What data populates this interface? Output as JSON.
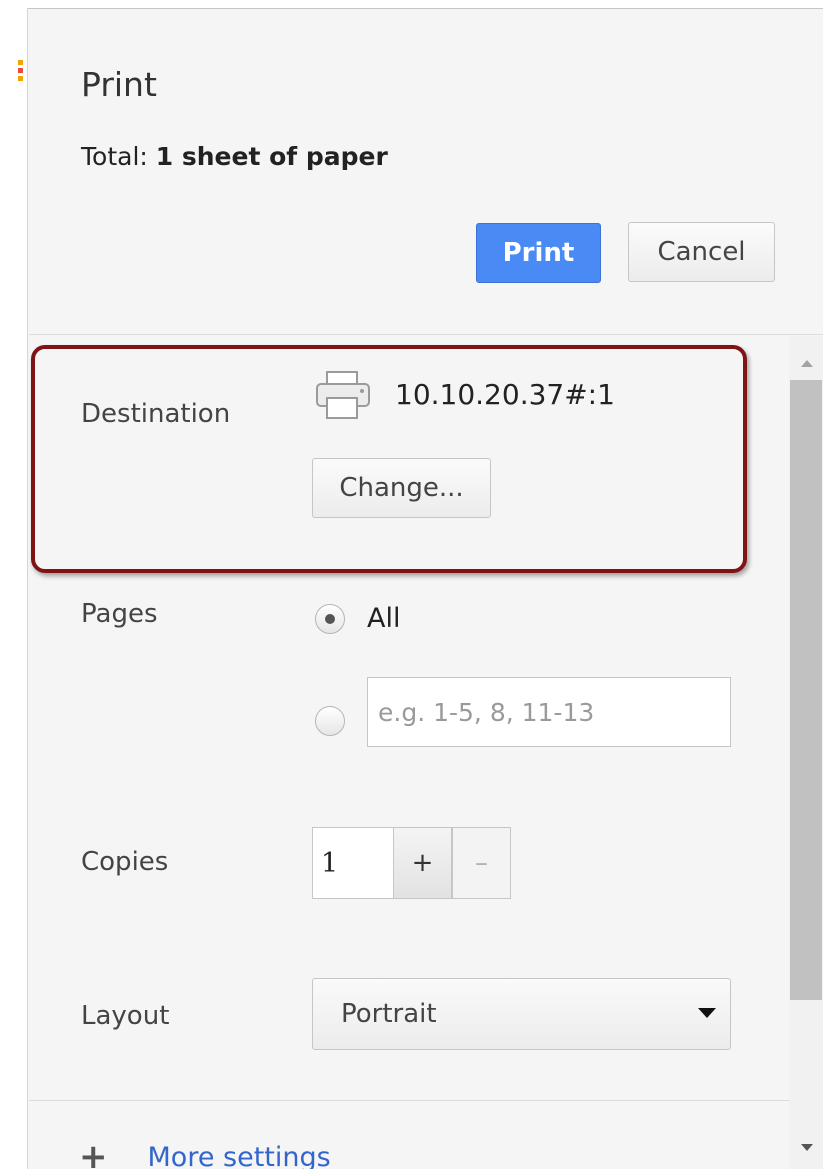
{
  "dialog": {
    "title": "Print",
    "total_label": "Total:",
    "total_value": "1 sheet of paper",
    "print_button": "Print",
    "cancel_button": "Cancel"
  },
  "destination": {
    "label": "Destination",
    "printer_name": "10.10.20.37#:1",
    "change_button": "Change...",
    "icon": "printer-icon",
    "highlight_color": "#7e1416"
  },
  "pages": {
    "label": "Pages",
    "option_all": "All",
    "option_all_selected": true,
    "custom_placeholder": "e.g. 1-5, 8, 11-13",
    "custom_value": ""
  },
  "copies": {
    "label": "Copies",
    "value": "1",
    "increment": "+",
    "decrement": "–"
  },
  "layout": {
    "label": "Layout",
    "selected": "Portrait"
  },
  "more": {
    "label": "More settings",
    "icon": "+"
  },
  "colors": {
    "accent": "#4a8af4",
    "link": "#3366cc",
    "edge_marks": [
      "#f4a400",
      "#e74c3c",
      "#f4a400"
    ]
  }
}
